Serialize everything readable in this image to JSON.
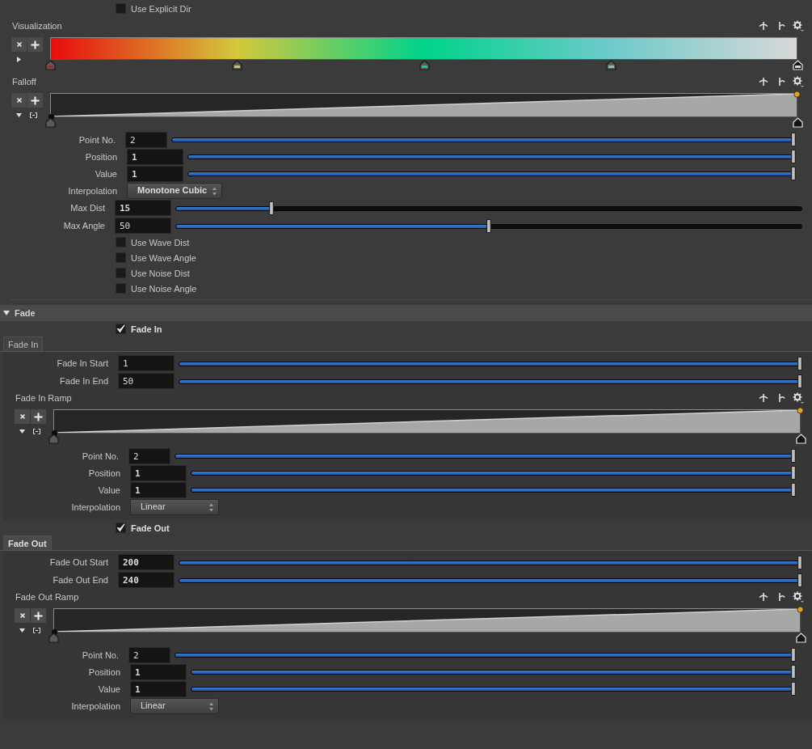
{
  "use_explicit_dir": {
    "label": "Use Explicit Dir",
    "checked": false
  },
  "visualization": {
    "label": "Visualization",
    "kind": "color",
    "expanded": false,
    "keys": [
      {
        "level": 0,
        "color": "#e80c0c",
        "selected": false
      },
      {
        "level": 0.25,
        "color": "#d4c83c",
        "selected": false
      },
      {
        "level": 0.5,
        "color": "#00d38a",
        "selected": false
      },
      {
        "level": 0.75,
        "color": "#6ecaca",
        "selected": false
      },
      {
        "level": 1,
        "color": "#d8d8d8",
        "selected": true
      }
    ]
  },
  "falloff": {
    "label": "Falloff",
    "kind": "float",
    "expanded": true,
    "keys": [
      {
        "level": 0,
        "selected": false
      },
      {
        "level": 1,
        "selected": true
      }
    ],
    "params": [
      {
        "kind": "int",
        "label": "Point No.",
        "value": "2",
        "modified": false,
        "level": 1
      },
      {
        "kind": "float",
        "label": "Position",
        "value": "1",
        "modified": true,
        "level": 1
      },
      {
        "kind": "float",
        "label": "Value",
        "value": "1",
        "modified": true,
        "level": 1
      },
      {
        "kind": "menu",
        "label": "Interpolation",
        "value": "Monotone Cubic",
        "modified": true
      }
    ]
  },
  "max_dist": {
    "label": "Max Dist",
    "value": "15",
    "modified": true,
    "level": 0.15
  },
  "max_angle": {
    "label": "Max Angle",
    "value": "50",
    "modified": false,
    "level": 0.5
  },
  "options": [
    {
      "label": "Use Wave Dist",
      "checked": false
    },
    {
      "label": "Use Wave Angle",
      "checked": false
    },
    {
      "label": "Use Noise Dist",
      "checked": false
    },
    {
      "label": "Use Noise Angle",
      "checked": false
    }
  ],
  "fade": {
    "label": "Fade",
    "expanded": true,
    "groups": [
      {
        "toggle": {
          "label": "Fade In",
          "checked": true
        },
        "tab": {
          "label": "Fade In",
          "modified": false
        },
        "params": [
          {
            "label": "Fade In Start",
            "value": "1",
            "modified": false,
            "level": 1
          },
          {
            "label": "Fade In End",
            "value": "50",
            "modified": false,
            "level": 1
          }
        ],
        "ramp": {
          "label": "Fade In Ramp",
          "kind": "float",
          "expanded": true,
          "keys": [
            {
              "level": 0,
              "selected": false
            },
            {
              "level": 1,
              "selected": true
            }
          ],
          "params": [
            {
              "kind": "int",
              "label": "Point No.",
              "value": "2",
              "modified": false,
              "level": 1
            },
            {
              "kind": "float",
              "label": "Position",
              "value": "1",
              "modified": true,
              "level": 1
            },
            {
              "kind": "float",
              "label": "Value",
              "value": "1",
              "modified": true,
              "level": 1
            },
            {
              "kind": "menu",
              "label": "Interpolation",
              "value": "Linear",
              "modified": false
            }
          ]
        }
      },
      {
        "toggle": {
          "label": "Fade Out",
          "checked": true
        },
        "tab": {
          "label": "Fade Out",
          "modified": true
        },
        "params": [
          {
            "label": "Fade Out Start",
            "value": "200",
            "modified": true,
            "level": 1
          },
          {
            "label": "Fade Out End",
            "value": "240",
            "modified": true,
            "level": 1
          }
        ],
        "ramp": {
          "label": "Fade Out Ramp",
          "kind": "float",
          "expanded": true,
          "keys": [
            {
              "level": 0,
              "selected": false
            },
            {
              "level": 1,
              "selected": true
            }
          ],
          "params": [
            {
              "kind": "int",
              "label": "Point No.",
              "value": "2",
              "modified": false,
              "level": 1
            },
            {
              "kind": "float",
              "label": "Position",
              "value": "1",
              "modified": true,
              "level": 1
            },
            {
              "kind": "float",
              "label": "Value",
              "value": "1",
              "modified": true,
              "level": 1
            },
            {
              "kind": "menu",
              "label": "Interpolation",
              "value": "Linear",
              "modified": false
            }
          ]
        }
      }
    ]
  }
}
